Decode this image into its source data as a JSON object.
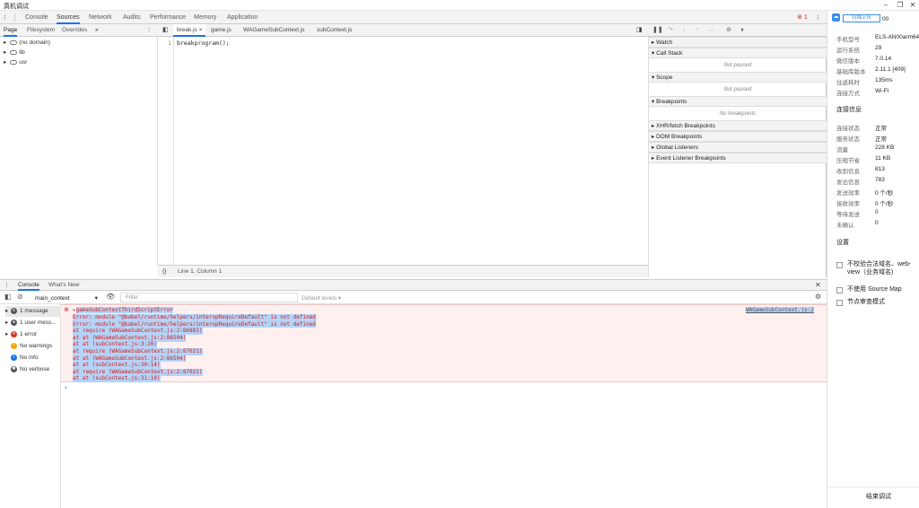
{
  "window": {
    "title": "真机调试"
  },
  "devtools_tabs": [
    {
      "label": "Console"
    },
    {
      "label": "Sources"
    },
    {
      "label": "Network"
    },
    {
      "label": "Audits"
    },
    {
      "label": "Performance"
    },
    {
      "label": "Memory"
    },
    {
      "label": "Application"
    }
  ],
  "error_count": "1",
  "navigator": {
    "tabs": [
      "Page",
      "Filesystem",
      "Overrides"
    ],
    "tree": [
      "(no domain)",
      "lib",
      "usr"
    ]
  },
  "editor": {
    "tabs": [
      "break.js",
      "game.js",
      "WAGameSubContext.js",
      "subContext.js"
    ],
    "line_number": "1",
    "code_line": "breakprogram();",
    "status": "Line 1, Column 1",
    "braces": "{}"
  },
  "debugger": {
    "sections": [
      "Watch",
      "Call Stack",
      "Scope",
      "Breakpoints",
      "XHR/fetch Breakpoints",
      "DOM Breakpoints",
      "Global Listeners",
      "Event Listener Breakpoints"
    ],
    "not_paused": "Not paused",
    "no_breakpoints": "No breakpoints"
  },
  "console": {
    "tabs": [
      "Console",
      "What's New"
    ],
    "context": "main_context",
    "filter_placeholder": "Filter",
    "levels": "Default levels ▾",
    "sidebar": [
      {
        "label": "1 message",
        "icon": "list-icon",
        "color": "#555555"
      },
      {
        "label": "1 user mess...",
        "icon": "user-icon",
        "color": "#555555"
      },
      {
        "label": "1 error",
        "icon": "error-icon",
        "color": "#d93025"
      },
      {
        "label": "No warnings",
        "icon": "warning-icon",
        "color": "#f2a600"
      },
      {
        "label": "No info",
        "icon": "info-icon",
        "color": "#1a73e8"
      },
      {
        "label": "No verbose",
        "icon": "verbose-icon",
        "color": "#555555"
      }
    ],
    "error_title": "gameSubContextThirdScriptError",
    "error_source": "WAGameSubContext.js:2",
    "error_lines": [
      "Error: module \"@babel/runtime/helpers/interopRequireDefault\" is not defined",
      "Error: module \"@babel/runtime/helpers/interopRequireDefault\" is not defined",
      "at require (WAGameSubContext.js:2:86883)",
      "at at (WAGameSubContext.js:2:86504)",
      "at at (subContext.js:3:20)",
      "at require (WAGameSubContext.js:2:87021)",
      "at at (WAGameSubContext.js:2:86504)",
      "at at (subContext.js:30:14)",
      "at require (WAGameSubContext.js:2:87021)",
      "at at (subContext.js:31:10)"
    ],
    "prompt": "›"
  },
  "right_panel": {
    "upload_label": "扫描上传",
    "partial_value": "00",
    "device_rows": [
      {
        "label": "手机型号",
        "value": "ELS-AN00arm64..."
      },
      {
        "label": "运行系统",
        "value": "29"
      },
      {
        "label": "微信版本",
        "value": "7.0.14"
      },
      {
        "label": "基础库版本",
        "value": "2.11.1 [409]"
      },
      {
        "label": "往返耗时",
        "value": "135ms"
      },
      {
        "label": "连接方式",
        "value": "Wi-Fi"
      }
    ],
    "conn_header": "连接信息",
    "conn_rows": [
      {
        "label": "连接状态",
        "value": "正常"
      },
      {
        "label": "服务状态",
        "value": "正常"
      },
      {
        "label": "流量",
        "value": "228 KB"
      },
      {
        "label": "压缩节省",
        "value": "11 KB"
      },
      {
        "label": "收到信息",
        "value": "813"
      },
      {
        "label": "发出信息",
        "value": "783"
      },
      {
        "label": "发送效率",
        "value": "0 个/秒"
      },
      {
        "label": "接收效率",
        "value": "0 个/秒"
      },
      {
        "label": "等待发送",
        "value": "0"
      },
      {
        "label": "未确认",
        "value": "0"
      }
    ],
    "settings_header": "设置",
    "settings": [
      "不校验合法域名、web-view（业务域名)",
      "不使用 Source Map",
      "节点审查模式"
    ],
    "end_button": "结束调试"
  },
  "colors": {
    "accent": "#1a73e8",
    "error_bg": "#fff0f0",
    "error_text": "#d61a1a",
    "selection": "#b5d3f7"
  }
}
